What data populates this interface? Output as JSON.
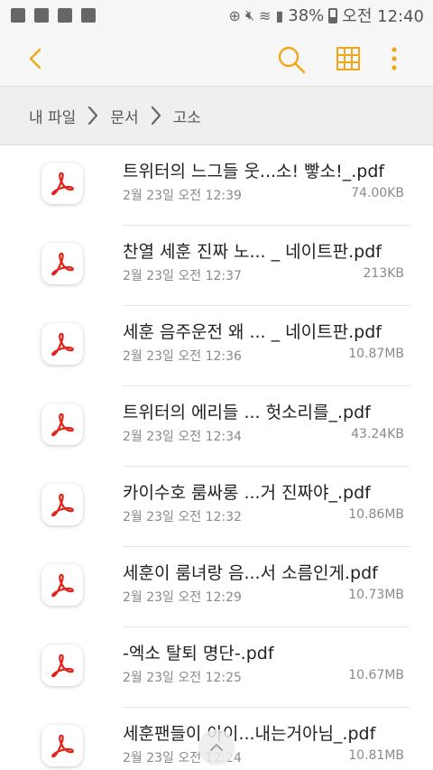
{
  "status_bar": {
    "battery": "38%",
    "time": "오전 12:40",
    "icons": [
      "app-icon",
      "image-icon",
      "gallery-icon",
      "sd-card-icon",
      "data-saver-icon",
      "mute-icon",
      "wifi-icon",
      "signal-icon",
      "battery-icon"
    ]
  },
  "toolbar": {
    "icons": [
      "back-icon",
      "search-icon",
      "grid-view-icon",
      "more-options-icon"
    ],
    "accent_color": "#f0a71a"
  },
  "breadcrumb": [
    "내 파일",
    "문서",
    "고소"
  ],
  "files": [
    {
      "name": "트위터의 느그들 웃...소! 빻소!_.pdf",
      "date": "2월 23일 오전 12:39",
      "size": "74.00KB"
    },
    {
      "name": "찬열 세훈 진짜 노... _ 네이트판.pdf",
      "date": "2월 23일 오전 12:37",
      "size": "213KB"
    },
    {
      "name": "세훈 음주운전 왜 ... _ 네이트판.pdf",
      "date": "2월 23일 오전 12:36",
      "size": "10.87MB"
    },
    {
      "name": "트위터의 에리들 ... 헛소리를_.pdf",
      "date": "2월 23일 오전 12:34",
      "size": "43.24KB"
    },
    {
      "name": "카이수호 룸싸롱 ...거 진짜야_.pdf",
      "date": "2월 23일 오전 12:32",
      "size": "10.86MB"
    },
    {
      "name": "세훈이 룸녀랑 음...서 소름인게.pdf",
      "date": "2월 23일 오전 12:29",
      "size": "10.73MB"
    },
    {
      "name": "-엑소 탈퇴 명단-.pdf",
      "date": "2월 23일 오전 12:25",
      "size": "10.67MB"
    },
    {
      "name": "세훈팬들이 아이...내는거아님_.pdf",
      "date": "2월 23일 오전 12:24",
      "size": "10.81MB"
    }
  ],
  "file_icon": "pdf-icon",
  "pdf_icon_color": "#e2231a"
}
